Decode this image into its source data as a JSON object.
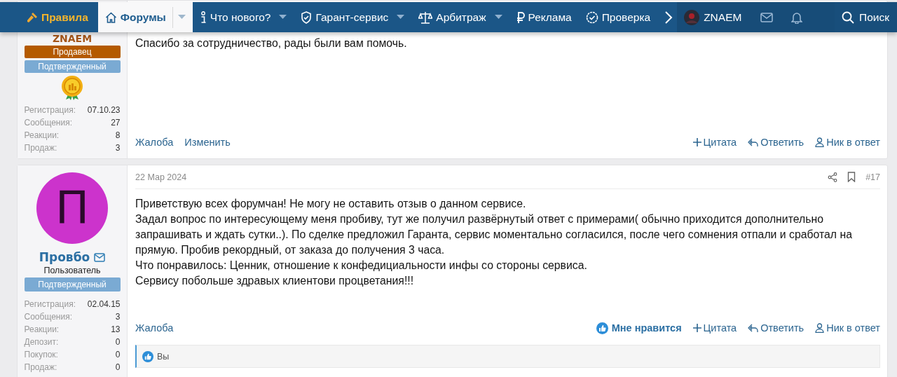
{
  "nav": {
    "items": [
      {
        "kind": "rules",
        "label": "Правила",
        "selected": false,
        "dropdown": false
      },
      {
        "kind": "home",
        "label": "Форумы",
        "selected": true,
        "dropdown": true
      },
      {
        "kind": "info",
        "label": "Что нового?",
        "selected": false,
        "dropdown": true
      },
      {
        "kind": "shield",
        "label": "Гарант-сервис",
        "selected": false,
        "dropdown": true
      },
      {
        "kind": "scales",
        "label": "Арбитраж",
        "selected": false,
        "dropdown": true
      },
      {
        "kind": "ruble",
        "label": "Реклама",
        "selected": false,
        "dropdown": false
      },
      {
        "kind": "check",
        "label": "Проверка",
        "selected": false,
        "dropdown": false
      }
    ],
    "user": "ZNAEM",
    "search": "Поиск"
  },
  "posts": [
    {
      "user": {
        "name": "ZNAEM",
        "badges": [
          {
            "label": "Продавец",
            "color": "#b45a00"
          },
          {
            "label": "Подтвержденный",
            "color": "#7aaad3"
          }
        ],
        "medal": true,
        "stats": [
          [
            "Регистрация:",
            "07.10.23"
          ],
          [
            "Сообщения:",
            "27"
          ],
          [
            "Реакции:",
            "8"
          ],
          [
            "Продаж:",
            "3"
          ]
        ]
      },
      "paragraphs": [
        "Спасибо за сотрудничество, рады были вам помочь."
      ],
      "left_actions": [
        "Жалоба",
        "Изменить"
      ],
      "right_actions": [
        {
          "kind": "quote",
          "label": "Цитата"
        },
        {
          "kind": "reply",
          "label": "Ответить"
        },
        {
          "kind": "mention",
          "label": "Ник в ответ"
        }
      ]
    },
    {
      "user": {
        "avatar_letter": "П",
        "name": "Провбо",
        "title": "Пользователь",
        "badges": [
          {
            "label": "Подтвержденный",
            "color": "#7aaad3"
          }
        ],
        "medal": false,
        "stats": [
          [
            "Регистрация:",
            "02.04.15"
          ],
          [
            "Сообщения:",
            "3"
          ],
          [
            "Реакции:",
            "13"
          ],
          [
            "Депозит:",
            "0"
          ],
          [
            "Покупок:",
            "0"
          ],
          [
            "Продаж:",
            "0"
          ]
        ]
      },
      "date": "22 Мар 2024",
      "number": "#17",
      "paragraphs": [
        "Приветствую всех форумчан! Не могу не оставить отзыв о данном сервисе.",
        "Задал вопрос по интересующему меня пробиву, тут же получил развёрнутый ответ с примерами( обычно приходится дополнительно запрашивать и ждать сутки..). По сделке предложил Гаранта, сервис моментально согласился, после чего сомнения отпали и сработал на прямую. Пробив рекордный, от заказа до получения 3 часа.",
        "Что понравилось: Ценник, отношение к конфедициальности инфы со стороны сервиса.",
        "Сервису побольше здравых клиентови процветания!!!"
      ],
      "left_actions": [
        "Жалоба"
      ],
      "right_actions": [
        {
          "kind": "like",
          "label": "Мне нравится"
        },
        {
          "kind": "quote",
          "label": "Цитата"
        },
        {
          "kind": "reply",
          "label": "Ответить"
        },
        {
          "kind": "mention",
          "label": "Ник в ответ"
        }
      ],
      "reactions": "Вы"
    }
  ]
}
